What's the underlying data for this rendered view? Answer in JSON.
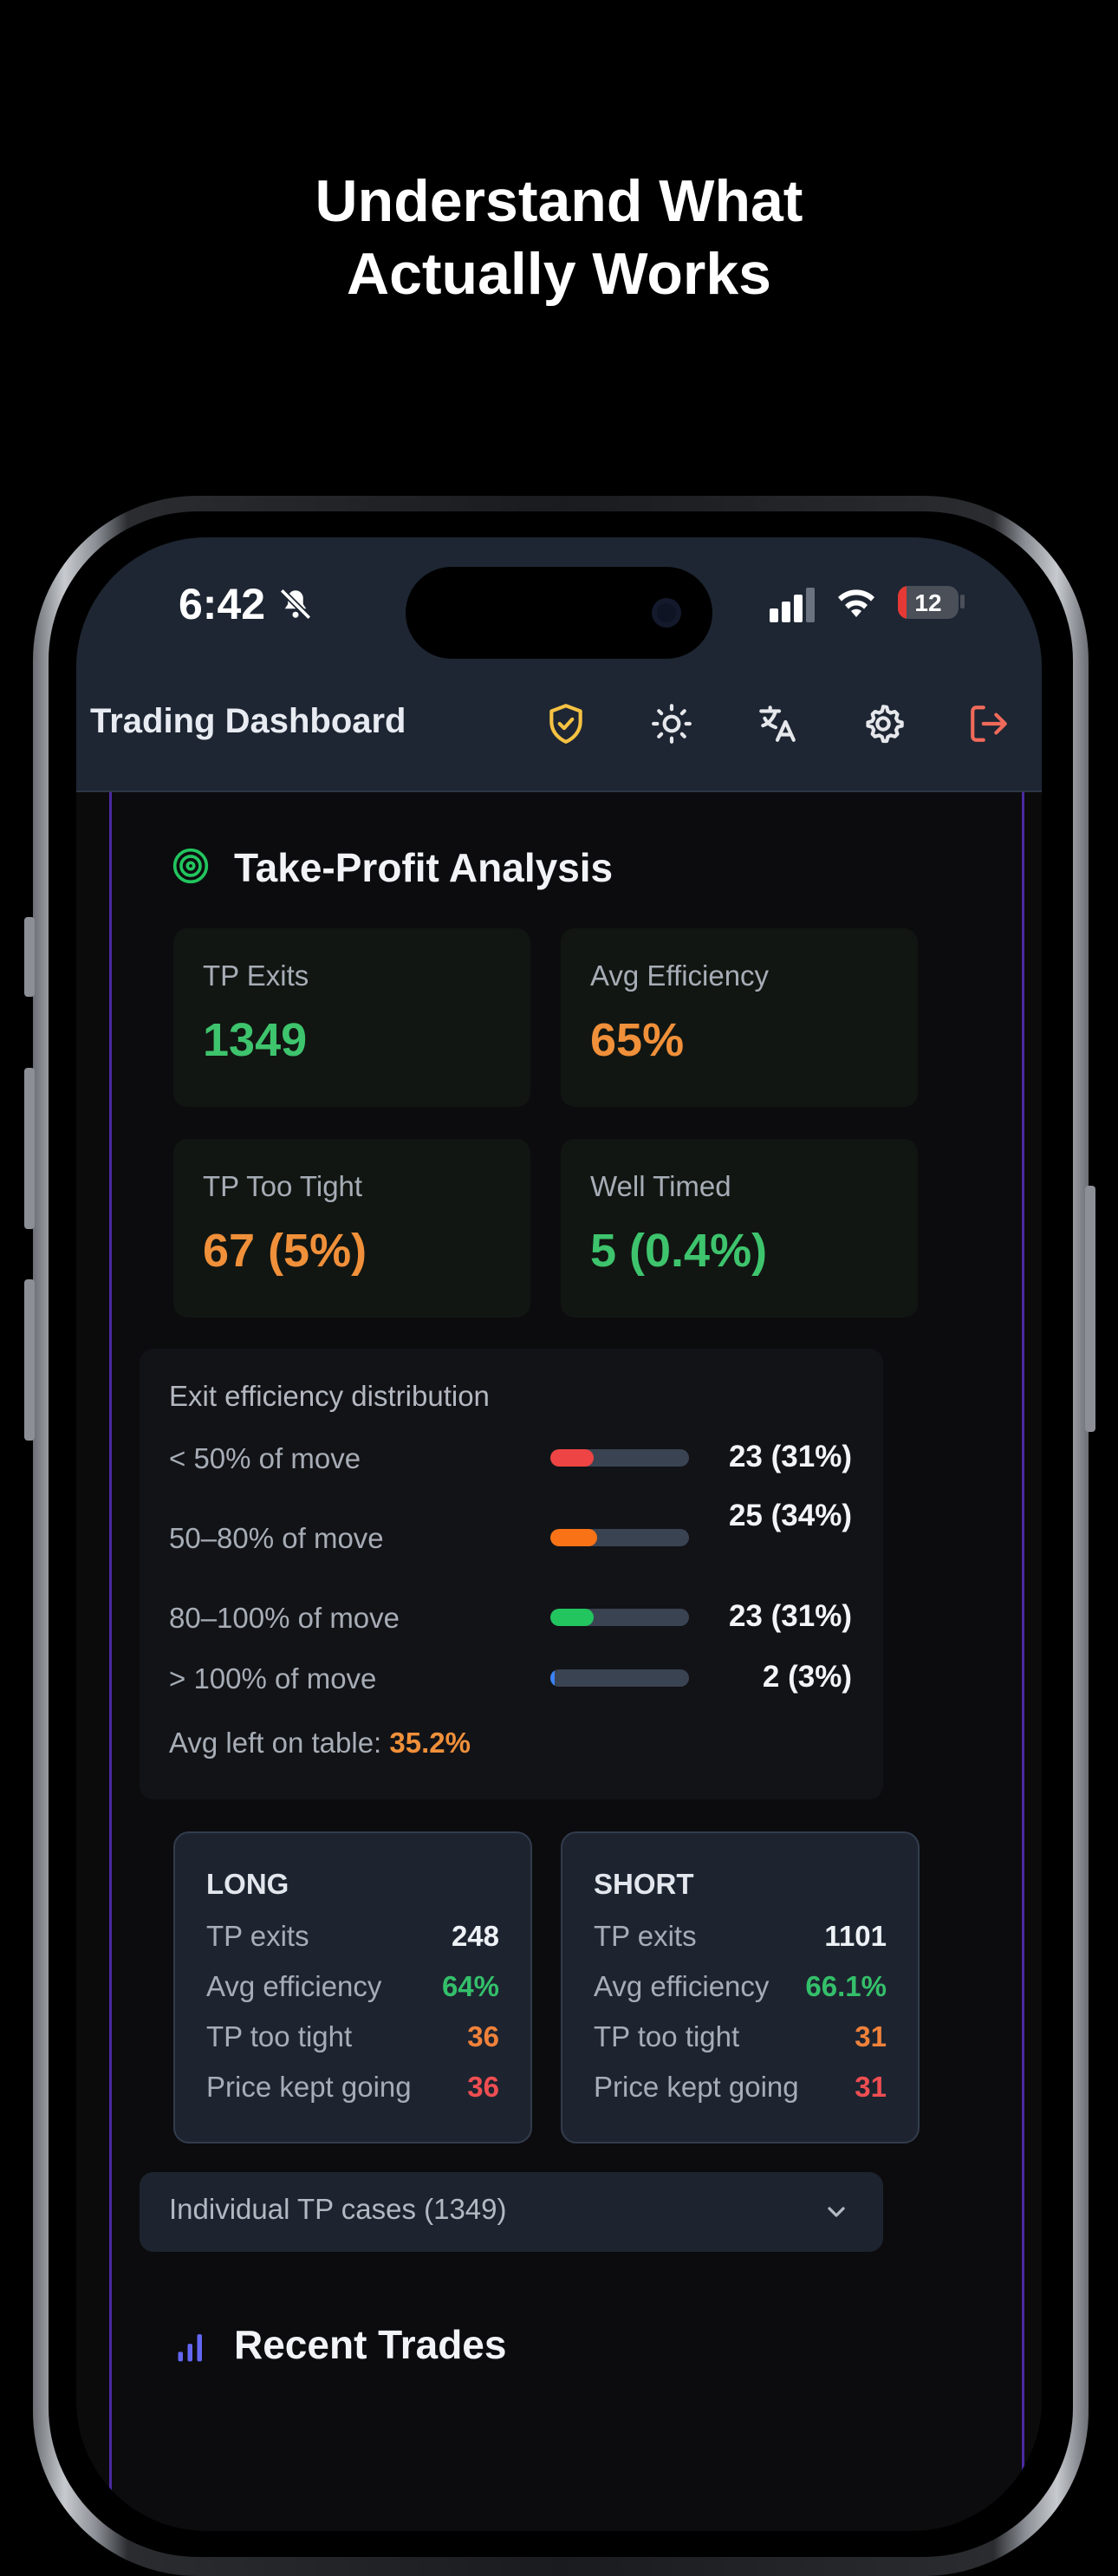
{
  "headline": {
    "line1": "Understand What",
    "line2": "Actually Works"
  },
  "status_bar": {
    "time": "6:42",
    "battery": "12"
  },
  "app_bar": {
    "title": "Trading Dashboard",
    "icons": [
      "shield-check-icon",
      "sun-icon",
      "translate-icon",
      "gear-icon",
      "logout-icon"
    ],
    "colors": {
      "shield": "#f5c242",
      "logout": "#f06a5a"
    }
  },
  "tp_analysis": {
    "title": "Take-Profit Analysis",
    "stats": [
      {
        "label": "TP Exits",
        "value": "1349",
        "color": "green"
      },
      {
        "label": "Avg Efficiency",
        "value": "65%",
        "color": "orange"
      },
      {
        "label": "TP Too Tight",
        "value": "67 (5%)",
        "color": "orange"
      },
      {
        "label": "Well Timed",
        "value": "5 (0.4%)",
        "color": "green"
      }
    ],
    "distribution": {
      "heading": "Exit efficiency distribution",
      "rows": [
        {
          "label": "< 50% of move",
          "value": "23 (31%)",
          "fraction": 0.31,
          "color": "#ef4444"
        },
        {
          "label": "50–80% of move",
          "value": "25 (34%)",
          "fraction": 0.34,
          "color": "#f97316"
        },
        {
          "label": "80–100% of move",
          "value": "23 (31%)",
          "fraction": 0.31,
          "color": "#22c55e"
        },
        {
          "label": "> 100% of move",
          "value": "2 (3%)",
          "fraction": 0.03,
          "color": "#3b82f6"
        }
      ],
      "leftover_label": "Avg left on table: ",
      "leftover_value": "35.2%"
    },
    "long": {
      "title": "LONG",
      "rows": [
        {
          "k": "TP exits",
          "v": "248"
        },
        {
          "k": "Avg efficiency",
          "v": "64%"
        },
        {
          "k": "TP too tight",
          "v": "36"
        },
        {
          "k": "Price kept going",
          "v": "36"
        }
      ]
    },
    "short": {
      "title": "SHORT",
      "rows": [
        {
          "k": "TP exits",
          "v": "1101"
        },
        {
          "k": "Avg efficiency",
          "v": "66.1%"
        },
        {
          "k": "TP too tight",
          "v": "31"
        },
        {
          "k": "Price kept going",
          "v": "31"
        }
      ]
    },
    "cases_label": "Individual TP cases (1349)"
  },
  "recent_trades": {
    "title": "Recent Trades"
  }
}
